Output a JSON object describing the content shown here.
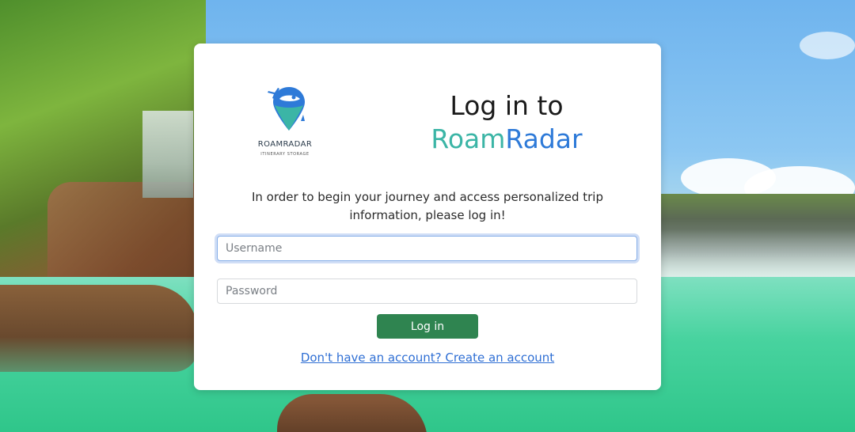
{
  "logo": {
    "name": "ROAMRADAR",
    "tagline": "ITINERARY STORAGE",
    "icon": "map-pin-icon"
  },
  "heading": {
    "line1": "Log in to",
    "brand_part1": "Roam",
    "brand_part2": "Radar"
  },
  "intro_text": "In order to begin your journey and access personalized trip information, please log in!",
  "form": {
    "username_placeholder": "Username",
    "username_value": "",
    "password_placeholder": "Password",
    "password_value": "",
    "login_label": "Log in"
  },
  "signup_link": "Don't have an account? Create an account",
  "colors": {
    "brand_teal": "#3bb5a6",
    "brand_blue": "#2e7ad8",
    "button_green": "#2f8450",
    "link_blue": "#2f6fd4"
  }
}
